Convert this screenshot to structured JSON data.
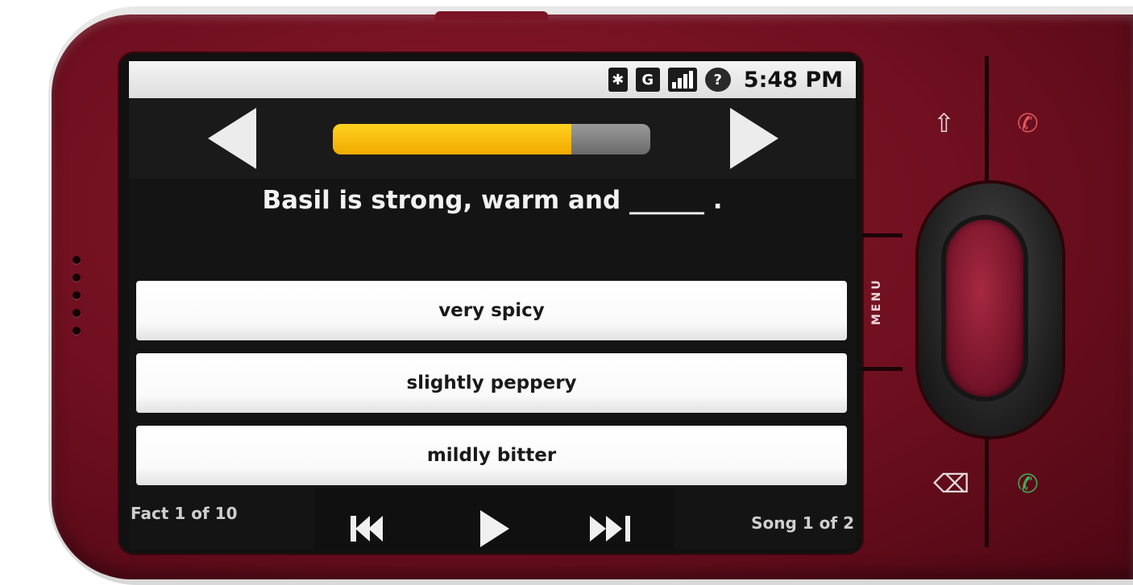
{
  "status_bar": {
    "icons": [
      "bluetooth-icon",
      "gprs-icon",
      "signal-icon",
      "help-icon"
    ],
    "bluetooth_glyph": "✱",
    "gprs_glyph": "G",
    "help_glyph": "?",
    "time": "5:48 PM"
  },
  "quiz": {
    "progress_fraction": 0.75,
    "question": "Basil is strong, warm and ______ .",
    "answers": [
      "very spicy",
      "slightly peppery",
      "mildly bitter"
    ]
  },
  "footer": {
    "fact_counter": "Fact 1 of 10",
    "song_counter": "Song 1 of 2"
  },
  "hardware": {
    "menu_label": "MENU",
    "icons": [
      "home-icon",
      "end-call-icon",
      "back-icon",
      "call-icon"
    ],
    "home_glyph": "⇧",
    "end_call_glyph": "✆",
    "back_glyph": "⌫",
    "call_glyph": "✆"
  },
  "colors": {
    "phone_body": "#6e0f1f",
    "progress_fill": "#f2a900",
    "end_call": "#e0585e",
    "call": "#3fae5a"
  }
}
